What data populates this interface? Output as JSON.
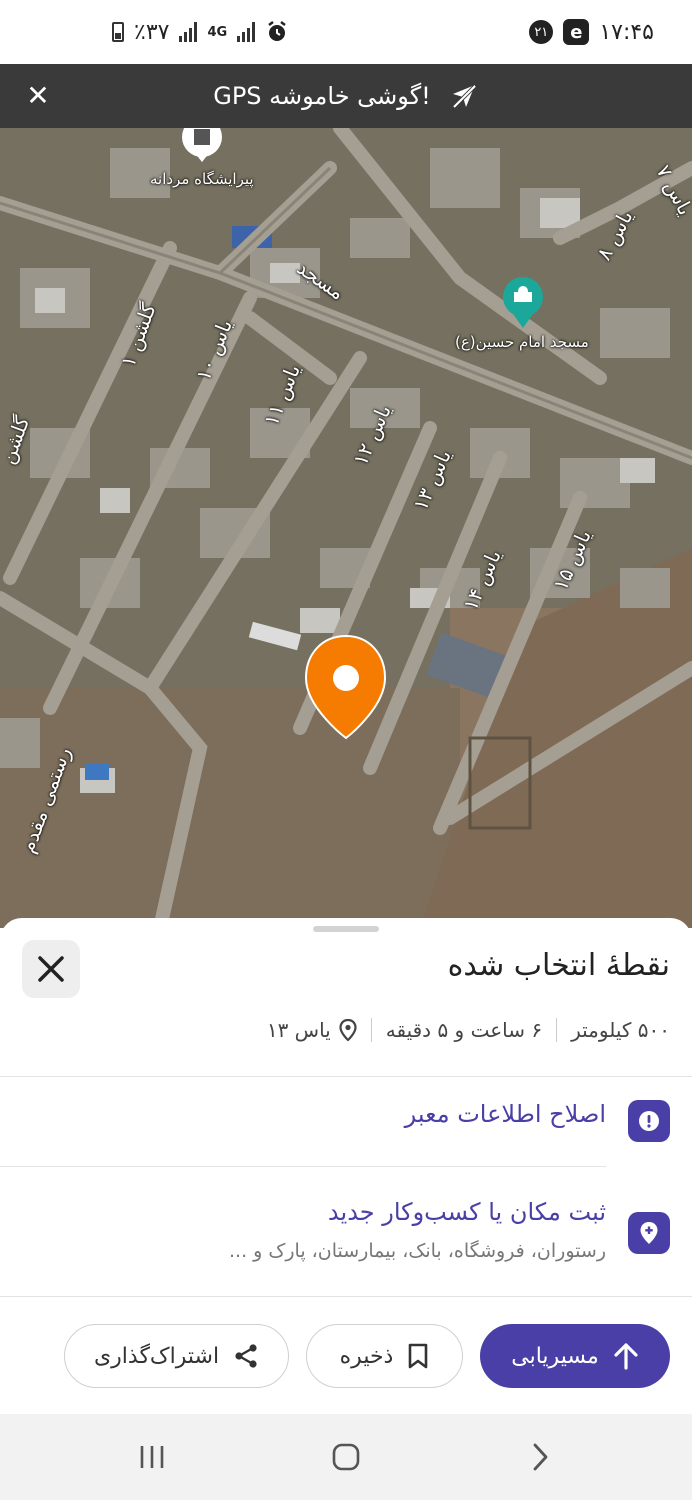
{
  "status_bar": {
    "time": "۱۷:۴۵",
    "notification_count": "۲۱",
    "battery": "٪۳۷",
    "network": "4G",
    "icons": [
      "e-app-icon",
      "alarm-icon",
      "signal-icon",
      "battery-icon"
    ]
  },
  "gps_banner": {
    "text": "GPS گوشی خاموشه!",
    "icons": [
      "gps-off-icon",
      "close-icon"
    ]
  },
  "map": {
    "pois": [
      {
        "label": "پیرایشگاه مردانه",
        "icon": "barber-icon"
      },
      {
        "label": "مسجد امام حسین(ع)",
        "icon": "mosque-icon"
      }
    ],
    "streets": [
      "مسجد",
      "یاس ۸",
      "یاس ۷",
      "گلشن ۱",
      "یاس ۱۰",
      "یاس ۱۱",
      "یاس ۱۲",
      "یاس ۱۳",
      "یاس ۱۴",
      "یاس ۱۵",
      "گلشن",
      "رستمی مقدم"
    ],
    "marker": "location-pin-icon",
    "colors": {
      "pin": "#f57c00"
    }
  },
  "sheet": {
    "title": "نقطهٔ انتخاب شده",
    "location": "یاس ۱۳",
    "duration": "۶ ساعت و ۵ دقیقه",
    "distance": "۵۰۰ کیلومتر",
    "actions": [
      {
        "title": "اصلاح اطلاعات معبر",
        "icon": "exclamation-icon"
      },
      {
        "title": "ثبت مکان یا کسب‌وکار جدید",
        "subtitle": "رستوران، فروشگاه، بانک، بیمارستان، پارک و ...",
        "icon": "add-place-icon"
      }
    ],
    "buttons": {
      "route": "مسیریابی",
      "save": "ذخیره",
      "share": "اشتراک‌گذاری"
    },
    "colors": {
      "accent": "#4a3fa7"
    }
  },
  "navbar": {
    "icons": [
      "recent-apps-icon",
      "home-icon",
      "back-icon"
    ]
  }
}
